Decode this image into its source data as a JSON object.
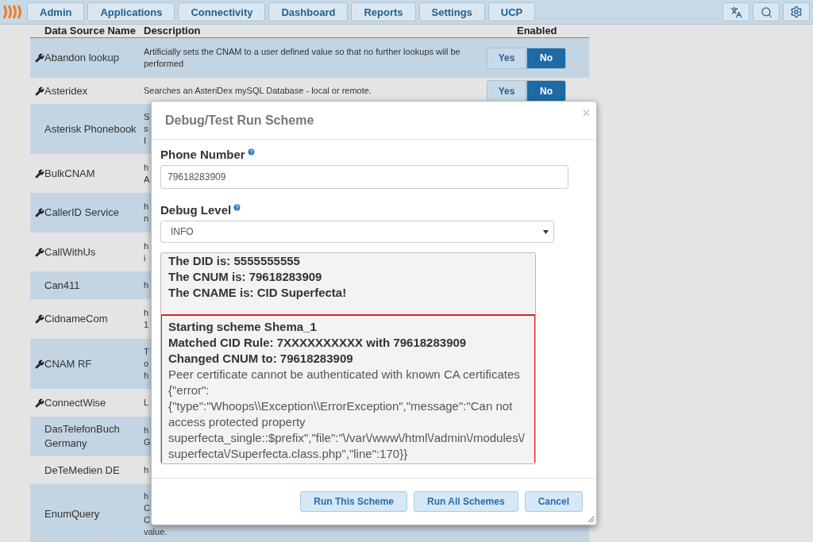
{
  "nav": {
    "items": [
      {
        "label": "Admin"
      },
      {
        "label": "Applications"
      },
      {
        "label": "Connectivity"
      },
      {
        "label": "Dashboard"
      },
      {
        "label": "Reports"
      },
      {
        "label": "Settings"
      },
      {
        "label": "UCP"
      }
    ]
  },
  "table": {
    "columns": [
      "Data Source Name",
      "Description",
      "Enabled"
    ],
    "rows": [
      {
        "name": "Abandon lookup",
        "configurable": true,
        "description": [
          "Artificially sets the CNAM to a user defined value so that no further lookups will be performed"
        ],
        "toggle": [
          {
            "label": "Yes",
            "selected": false
          },
          {
            "label": "No",
            "selected": true
          }
        ]
      },
      {
        "name": "Asteridex",
        "configurable": true,
        "description": [
          "Searches an AsteriDex mySQL Database - local or remote."
        ],
        "toggle": [
          {
            "label": "Yes",
            "selected": false
          },
          {
            "label": "No",
            "selected": true
          }
        ]
      },
      {
        "name": "Asterisk Phonebook",
        "configurable": false,
        "description": [
          "S",
          "s",
          "I"
        ]
      },
      {
        "name": "BulkCNAM",
        "configurable": true,
        "description": [
          "h",
          "A"
        ]
      },
      {
        "name": "CallerID Service",
        "configurable": true,
        "description": [
          "h",
          "n"
        ]
      },
      {
        "name": "CallWithUs",
        "configurable": true,
        "description": [
          "h",
          "i"
        ]
      },
      {
        "name": "Can411",
        "configurable": false,
        "description": [
          "h"
        ]
      },
      {
        "name": "CidnameCom",
        "configurable": true,
        "description": [
          "h",
          "1"
        ]
      },
      {
        "name": "CNAM RF",
        "configurable": true,
        "description": [
          "T",
          "o",
          "h"
        ]
      },
      {
        "name": "ConnectWise",
        "configurable": true,
        "description": [
          "L"
        ]
      },
      {
        "name": "DasTelefonBuch Germany",
        "configurable": false,
        "description": [
          "h",
          "G"
        ]
      },
      {
        "name": "DeTeMedien DE",
        "configurable": false,
        "description": [
          "h"
        ]
      },
      {
        "name": "EnumQuery",
        "configurable": false,
        "description": [
          "h",
          "C",
          "C",
          "value."
        ]
      }
    ]
  },
  "dialog": {
    "title": "Debug/Test Run Scheme",
    "close": "×",
    "phone_number": {
      "label": "Phone Number",
      "value": "79618283909"
    },
    "debug_level": {
      "label": "Debug Level",
      "value": "INFO"
    },
    "log": {
      "lines": [
        {
          "kind": "bold",
          "text": "The DID is: 5555555555"
        },
        {
          "kind": "bold",
          "text": "The CNUM is: 79618283909"
        },
        {
          "kind": "bold",
          "text": "The CNAME is: CID Superfecta!"
        }
      ],
      "highlighted": [
        {
          "kind": "bold",
          "text": "Starting scheme Shema_1"
        },
        {
          "kind": "bold",
          "text": "Matched CID Rule: 7XXXXXXXXXX with 79618283909"
        },
        {
          "kind": "bold",
          "text": "Changed CNUM to: 79618283909"
        },
        {
          "kind": "normal",
          "text": "Peer certificate cannot be authenticated with known CA certificates {\"error\":{\"type\":\"Whoops\\\\Exception\\\\ErrorException\",\"message\":\"Can not access protected property superfecta_single::$prefix\",\"file\":\"\\/var\\/www\\/html\\/admin\\/modules\\/superfecta\\/Superfecta.class.php\",\"line\":170}}"
        }
      ]
    },
    "buttons": [
      "Run This Scheme",
      "Run All Schemes",
      "Cancel"
    ]
  }
}
